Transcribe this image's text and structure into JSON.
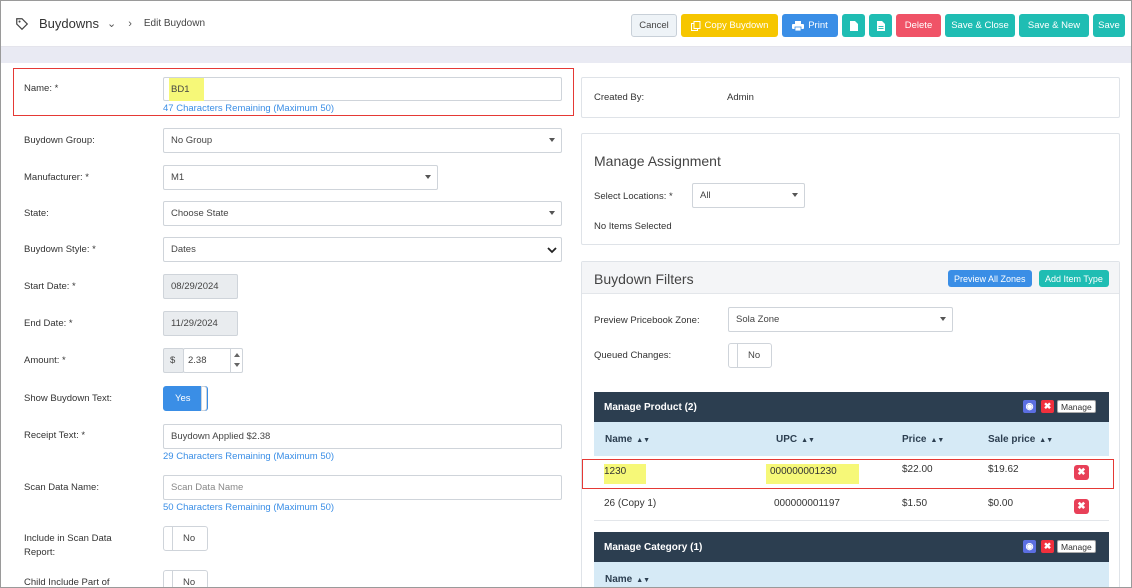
{
  "header": {
    "module": "Buydowns",
    "current": "Edit Buydown",
    "buttons": {
      "cancel": "Cancel",
      "copy": "Copy Buydown",
      "print": "Print",
      "delete": "Delete",
      "save_close": "Save & Close",
      "save_new": "Save & New",
      "save": "Save"
    }
  },
  "form": {
    "name_label": "Name: *",
    "name_value": "BD1",
    "name_hint": "47 Characters Remaining (Maximum 50)",
    "group_label": "Buydown Group:",
    "group_value": "No Group",
    "manufacturer_label": "Manufacturer: *",
    "manufacturer_value": "M1",
    "state_label": "State:",
    "state_value": "Choose State",
    "style_label": "Buydown Style: *",
    "style_value": "Dates",
    "start_label": "Start Date: *",
    "start_value": "08/29/2024",
    "end_label": "End Date: *",
    "end_value": "11/29/2024",
    "amount_label": "Amount: *",
    "amount_prefix": "$",
    "amount_value": "2.38",
    "show_text_label": "Show Buydown Text:",
    "show_text_value": "Yes",
    "receipt_label": "Receipt Text: *",
    "receipt_value": "Buydown Applied $2.38",
    "receipt_hint": "29 Characters Remaining (Maximum 50)",
    "scan_label": "Scan Data Name:",
    "scan_placeholder": "Scan Data Name",
    "scan_hint": "50 Characters Remaining (Maximum 50)",
    "include_label_1": "Include in Scan Data",
    "include_label_2": "Report:",
    "include_value": "No",
    "child_label": "Child Include Part of",
    "child_value": "No"
  },
  "created": {
    "label": "Created By:",
    "value": "Admin"
  },
  "assignment": {
    "title": "Manage Assignment",
    "locations_label": "Select Locations: *",
    "locations_value": "All",
    "empty": "No Items Selected"
  },
  "filters": {
    "title": "Buydown Filters",
    "preview_all": "Preview All Zones",
    "add_item_type": "Add Item Type",
    "zone_label": "Preview Pricebook Zone:",
    "zone_value": "Sola Zone",
    "queued_label": "Queued Changes:",
    "queued_value": "No"
  },
  "product": {
    "title": "Manage Product (2)",
    "manage": "Manage",
    "cols": [
      "Name",
      "UPC",
      "Price",
      "Sale price"
    ],
    "rows": [
      {
        "name": "1230",
        "upc": "000000001230",
        "price": "$22.00",
        "sale": "$19.62"
      },
      {
        "name": "26 (Copy 1)",
        "upc": "000000001197",
        "price": "$1.50",
        "sale": "$0.00"
      }
    ]
  },
  "category": {
    "title": "Manage Category (1)",
    "manage": "Manage",
    "col": "Name"
  },
  "colors": {
    "teal": "#1fbdb3",
    "blue": "#3a8ee6",
    "red": "#f05367",
    "yellow": "#f6c600",
    "dark": "#2c3e50",
    "highlight": "#f6f878"
  }
}
